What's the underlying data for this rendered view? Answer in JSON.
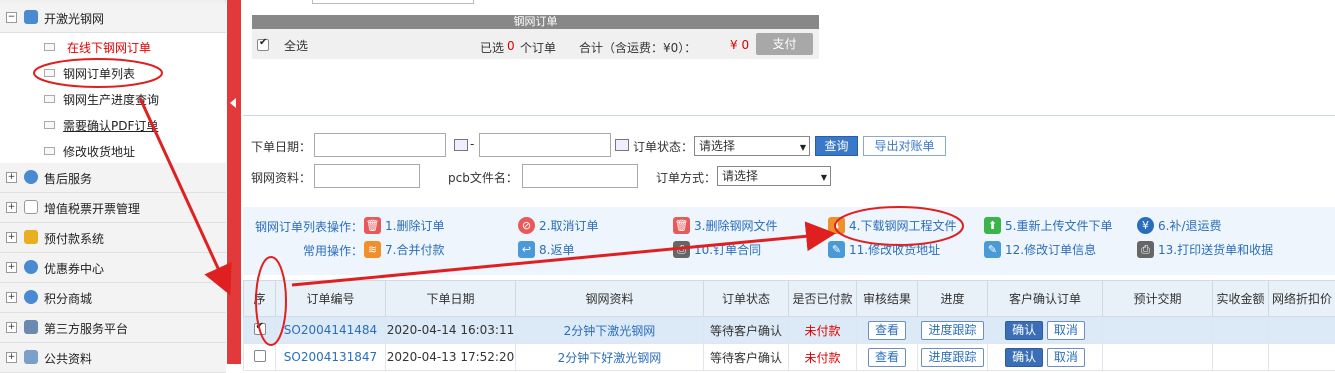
{
  "sidebar": {
    "groups": [
      {
        "label": "开激光钢网",
        "expanded": true
      },
      {
        "label": "售后服务"
      },
      {
        "label": "增值税票开票管理"
      },
      {
        "label": "预付款系统"
      },
      {
        "label": "优惠券中心"
      },
      {
        "label": "积分商城"
      },
      {
        "label": "第三方服务平台"
      },
      {
        "label": "公共资料"
      }
    ],
    "sub_items": [
      {
        "label": "在线下钢网订单",
        "color": "#e00000"
      },
      {
        "label": "钢网订单列表"
      },
      {
        "label": "钢网生产进度查询"
      },
      {
        "label": "需要确认PDF订单"
      },
      {
        "label": "修改收货地址"
      }
    ]
  },
  "summary": {
    "title": "钢网订单",
    "select_all": "全选",
    "selected_prefix": "已选",
    "selected_count": "0",
    "selected_suffix": "个订单",
    "total_label": "合计（含运费：¥0）：",
    "total_value": "¥ 0",
    "pay_button": "支付"
  },
  "filter": {
    "order_date_label": "下单日期：",
    "date_separator": "-",
    "status_label": "订单状态：",
    "status_value": "请选择",
    "query_button": "查询",
    "export_button": "导出对账单",
    "material_label": "钢网资料：",
    "pcb_label": "pcb文件名：",
    "method_label": "订单方式：",
    "method_value": "请选择"
  },
  "ops": {
    "list_ops_label": "钢网订单列表操作：",
    "common_ops_label": "常用操作：",
    "row1": [
      {
        "label": "1.删除订单",
        "icon": "trash-icon",
        "color": "#e85a5a"
      },
      {
        "label": "2.取消订单",
        "icon": "ban-icon",
        "color": "#e85a5a"
      },
      {
        "label": "3.删除钢网文件",
        "icon": "trash-icon",
        "color": "#e85a5a"
      },
      {
        "label": "4.下载钢网工程文件",
        "icon": "download-icon",
        "color": "#f0902a"
      },
      {
        "label": "5.重新上传文件下单",
        "icon": "upload-icon",
        "color": "#3bb54a"
      },
      {
        "label": "6.补/退运费",
        "icon": "yen-icon",
        "color": "#2a6ebb"
      }
    ],
    "row2": [
      {
        "label": "7.合并付款",
        "icon": "coins-icon",
        "color": "#f0902a"
      },
      {
        "label": "8.返单",
        "icon": "reply-icon",
        "color": "#4a9ad8"
      },
      {
        "label": "10.钉单合同",
        "icon": "print-icon",
        "color": "#666666"
      },
      {
        "label": "11.修改收货地址",
        "icon": "edit-icon",
        "color": "#4a9ad8"
      },
      {
        "label": "12.修改订单信息",
        "icon": "edit-icon",
        "color": "#4a9ad8"
      },
      {
        "label": "13.打印送货单和收据",
        "icon": "print-icon",
        "color": "#666666"
      }
    ]
  },
  "table": {
    "headers": [
      "序",
      "订单编号",
      "下单日期",
      "钢网资料",
      "订单状态",
      "是否已付款",
      "审核结果",
      "进度",
      "客户确认订单",
      "预计交期",
      "实收金额",
      "网络折扣价"
    ],
    "rows": [
      {
        "checked": true,
        "order_no": "SO2004141484",
        "date": "2020-04-14 16:03:11",
        "material": "2分钟下激光钢网",
        "status": "等待客户确认",
        "paid": "未付款",
        "audit": "查看",
        "progress": "进度跟踪",
        "confirm": "确认",
        "cancel": "取消"
      },
      {
        "checked": false,
        "order_no": "SO2004131847",
        "date": "2020-04-13 17:52:20",
        "material": "2分钟下好激光钢网",
        "status": "等待客户确认",
        "paid": "未付款",
        "audit": "查看",
        "progress": "进度跟踪",
        "confirm": "确认",
        "cancel": "取消"
      }
    ]
  },
  "colors": {
    "accent": "#3a78c9",
    "annotation": "#e02020",
    "collapse_bar": "#e23a3a"
  }
}
